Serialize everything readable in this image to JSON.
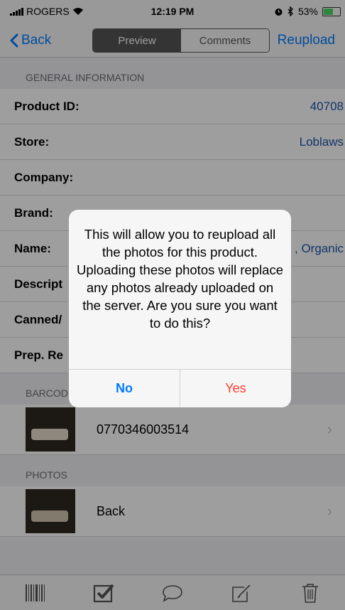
{
  "status_bar": {
    "carrier": "ROGERS",
    "time": "12:19 PM",
    "battery": "53%",
    "battery_level": 0.53
  },
  "nav_bar": {
    "back_label": "Back",
    "segments": [
      "Preview",
      "Comments"
    ],
    "active_segment": "Preview",
    "right_label": "Reupload"
  },
  "general_info": {
    "header": "GENERAL INFORMATION",
    "rows": [
      {
        "label": "Product ID:",
        "value": "40708"
      },
      {
        "label": "Store:",
        "value": "Loblaws"
      },
      {
        "label": "Company:",
        "value": ""
      },
      {
        "label": "Brand:",
        "value": ""
      },
      {
        "label": "Name:",
        "value": ", Organic"
      },
      {
        "label": "Descript",
        "value": ""
      },
      {
        "label": "Canned/",
        "value": ""
      },
      {
        "label": "Prep. Re",
        "value": ""
      }
    ]
  },
  "barcodes": {
    "header": "BARCODES",
    "items": [
      {
        "text": "0770346003514"
      }
    ]
  },
  "photos": {
    "header": "PHOTOS",
    "items": [
      {
        "text": "Back"
      }
    ]
  },
  "alert": {
    "message": "This will allow you to reupload all the photos for this product. Uploading these photos will replace any photos already uploaded on the server.  Are you sure you want to do this?",
    "no_label": "No",
    "yes_label": "Yes"
  },
  "toolbar": {
    "icons": [
      "barcode-icon",
      "checkbox-icon",
      "comment-icon",
      "edit-icon",
      "trash-icon"
    ]
  },
  "colors": {
    "accent": "#007aff",
    "destructive": "#ff3b30",
    "value_text": "#1d54a8",
    "battery_fill": "#4cd964"
  }
}
